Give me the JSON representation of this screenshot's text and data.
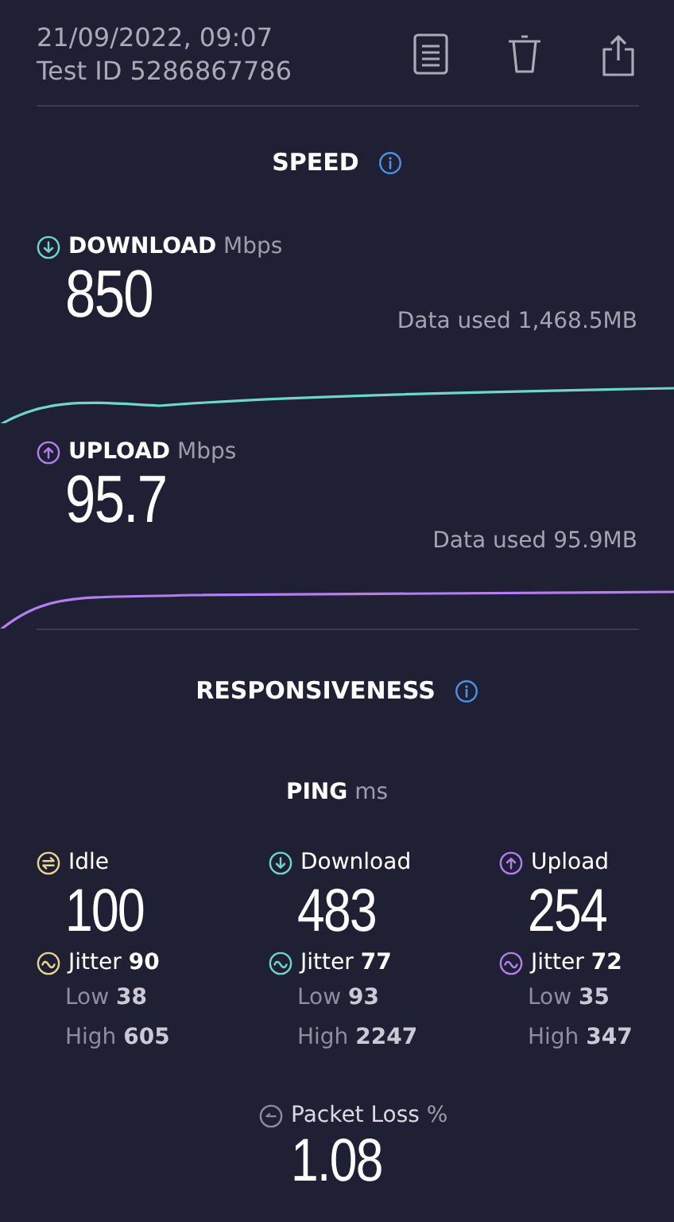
{
  "header": {
    "datetime": "21/09/2022, 09:07",
    "test_id": "Test ID 5286867786"
  },
  "speed": {
    "title": "SPEED",
    "tests": [
      {
        "kind": "download",
        "label": "DOWNLOAD",
        "unit": "Mbps",
        "value": "850",
        "data_used": "Data used 1,468.5MB"
      },
      {
        "kind": "upload",
        "label": "UPLOAD",
        "unit": "Mbps",
        "value": "95.7",
        "data_used": "Data used 95.9MB"
      }
    ]
  },
  "responsiveness": {
    "title": "RESPONSIVENESS",
    "ping_label": "PING",
    "ping_unit": "ms",
    "columns": [
      {
        "kind": "idle",
        "label": "Idle",
        "value": "100",
        "jitter_label": "Jitter",
        "jitter": "90",
        "low_label": "Low",
        "low": "38",
        "high_label": "High",
        "high": "605"
      },
      {
        "kind": "download",
        "label": "Download",
        "value": "483",
        "jitter_label": "Jitter",
        "jitter": "77",
        "low_label": "Low",
        "low": "93",
        "high_label": "High",
        "high": "2247"
      },
      {
        "kind": "upload",
        "label": "Upload",
        "value": "254",
        "jitter_label": "Jitter",
        "jitter": "72",
        "low_label": "Low",
        "low": "35",
        "high_label": "High",
        "high": "347"
      }
    ]
  },
  "packet_loss": {
    "label": "Packet Loss",
    "unit": "%",
    "value": "1.08"
  }
}
